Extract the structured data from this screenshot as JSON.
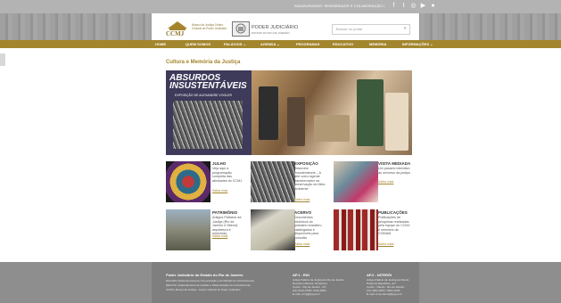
{
  "topbar": {
    "tagline": "INAUGURANDO: SENSIBIDADE E COLABORAÇÃO I",
    "social": [
      {
        "icon": "facebook-icon",
        "glyph": "f"
      },
      {
        "icon": "twitter-icon",
        "glyph": "t"
      },
      {
        "icon": "instagram-icon",
        "glyph": "◎"
      },
      {
        "icon": "youtube-icon",
        "glyph": "▶"
      },
      {
        "icon": "flickr-icon",
        "glyph": "●"
      }
    ]
  },
  "header": {
    "ccmj": "CCMJ",
    "ccmj_sub": "Museu da Justiça Centro Cultural do Poder Judiciário",
    "pj_title": "PODER JUDICIÁRIO",
    "pj_sub": "ESTADO DO RIO DE JANEIRO",
    "search_placeholder": "Buscar no portal"
  },
  "nav": {
    "items": [
      {
        "label": "HOME"
      },
      {
        "label": "QUEM SOMOS"
      },
      {
        "label": "PALÁCIOS  ⌄"
      },
      {
        "label": "AGENDA  ⌄"
      },
      {
        "label": "PROGRAMAS"
      },
      {
        "label": "EDUCATIVO"
      },
      {
        "label": "MEMÓRIA"
      },
      {
        "label": "INFORMAÇÕES  ⌄"
      }
    ]
  },
  "section_title": "Cultura e Memória da Justiça",
  "hero": {
    "title": "ABSURDOS INSUSTENTÁVEIS",
    "subtitle": "EXPOSIÇÃO DE ALEXANDRE VOGLER",
    "dots": 5
  },
  "cards": [
    {
      "title": "JULHO",
      "text": "Veja aqui a programação completa das atividades do CCMJ.",
      "more": "Saiba mais"
    },
    {
      "title": "EXPOSIÇÃO",
      "text": "Absurdos Insustentáveis – A arte como agente transformador na preservação do Meio Ambiente",
      "more": "Saiba mais"
    },
    {
      "title": "VISITA MEDIADA",
      "text": "Um passeio interativo ao universo da justiça",
      "more": "Saiba mais"
    },
    {
      "title": "PATRIMÔNIO",
      "text": "Antigos Palácios da Justiça (Rio de Janeiro e Niterói): arquitetura e memórias",
      "more": "Saiba mais"
    },
    {
      "title": "ACERVO",
      "text": "Documentos históricos do judiciário brasileiro catalogados e disponíveis para consulta",
      "more": "Saiba mais"
    },
    {
      "title": "PUBLICAÇÕES",
      "text": "Publicações de pesquisas realizadas pela equipe do CCMJ e memória da COMAM",
      "more": "Saiba mais"
    }
  ],
  "footer": {
    "title": "Poder Judiciário do Estado do Rio de Janeiro",
    "lines": [
      "DGCOM | Diretoria-Geral de Comunicação e de Difusão do Conhecimento",
      "DECCUL | Departamento de Gestão e Disseminação do Conhecimento",
      "CCMJ | Museu da Justiça - Centro Cultural do Poder Judiciário"
    ],
    "col2_title": "AP.1 - RIO",
    "col2_lines": [
      "Antigo Palácio da Justiça do Rio de Janeiro",
      "Rua Dom Manuel, 29 (térreo)",
      "Centro - Rio de Janeiro - RJ",
      "(21) 3133-3768 / 3133-3366",
      "E-mail: ccmj@tjrj.jus.br"
    ],
    "col3_title": "AP.2 - NITERÓI",
    "col3_lines": [
      "Antigo Palácio da Justiça de Niterói",
      "Praça da República, s/nº",
      "Centro - Niterói - Rio de Janeiro",
      "(21) 3602-2063 / 3602-4265",
      "E-mail: ccmj.niteroi@tjrj.jus.br"
    ]
  }
}
